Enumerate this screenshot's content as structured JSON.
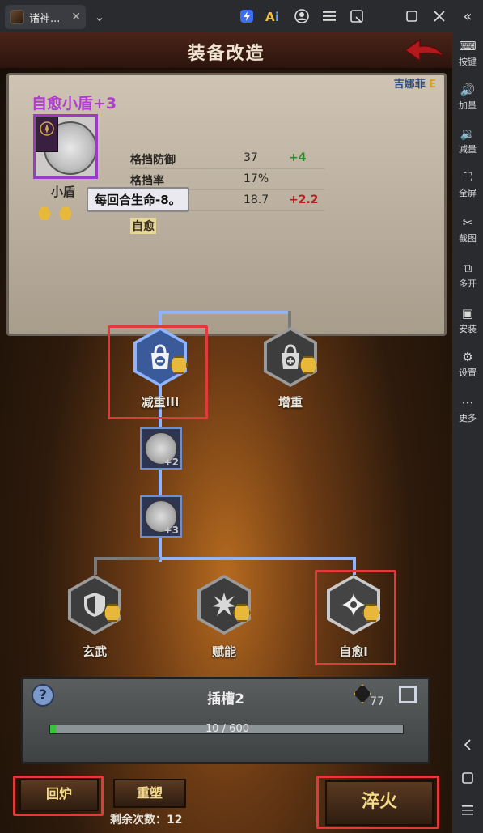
{
  "window": {
    "tab_title": "诸神...",
    "tab_close": "✕",
    "dropdown": "⌄",
    "toolbar_icons": [
      "bolt-icon",
      "ai-icon",
      "user-icon",
      "menu-icon",
      "popout-icon",
      "maximize-icon",
      "close-icon"
    ]
  },
  "sidebar": {
    "collapse": "«",
    "items": [
      {
        "label": "按键",
        "icon": "keyboard-icon",
        "glyph": "⌨"
      },
      {
        "label": "加量",
        "icon": "volume-up-icon",
        "glyph": "🔊"
      },
      {
        "label": "减量",
        "icon": "volume-down-icon",
        "glyph": "🔉"
      },
      {
        "label": "全屏",
        "icon": "fullscreen-icon",
        "glyph": "⛶"
      },
      {
        "label": "截图",
        "icon": "scissors-icon",
        "glyph": "✂"
      },
      {
        "label": "多开",
        "icon": "multi-instance-icon",
        "glyph": "⧉"
      },
      {
        "label": "安装",
        "icon": "apk-icon",
        "glyph": "▣"
      },
      {
        "label": "设置",
        "icon": "gear-icon",
        "glyph": "⚙"
      },
      {
        "label": "更多",
        "icon": "more-icon",
        "glyph": "⋯"
      }
    ],
    "bottom": [
      "back-icon",
      "home-icon",
      "recents-icon"
    ]
  },
  "header": {
    "title": "装备改造"
  },
  "item": {
    "name": "自愈小盾+3",
    "owner": "吉娜菲",
    "grade": "E",
    "label": "小盾",
    "stats": [
      {
        "name": "格挡防御",
        "value": "37",
        "delta": "+4",
        "delta_color": "#2e8b2e"
      },
      {
        "name": "格挡率",
        "value": "17%",
        "delta": "",
        "delta_color": ""
      },
      {
        "name": "",
        "value": "18.7",
        "delta": "+2.2",
        "delta_color": "#b02020"
      }
    ],
    "skill": "自愈",
    "tooltip": "每回合生命-8。"
  },
  "tree": {
    "nodes": [
      {
        "label": "减重III"
      },
      {
        "label": "增重"
      },
      {
        "label": "玄武"
      },
      {
        "label": "赋能"
      },
      {
        "label": "自愈I"
      }
    ],
    "runes": [
      {
        "num": "+2"
      },
      {
        "num": "+3"
      }
    ]
  },
  "slot": {
    "title": "插槽2",
    "help": "?",
    "cost": "77",
    "progress_text": "10 / 600",
    "progress_fraction": 0.0167
  },
  "buttons": {
    "recycle": "回炉",
    "reshape": "重塑",
    "remaining": "剩余次数：12",
    "quench": "淬火"
  }
}
